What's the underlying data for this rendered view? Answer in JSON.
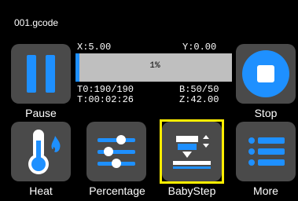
{
  "file_name": "001.gcode",
  "status": {
    "x": "X:5.00",
    "y": "Y:0.00",
    "progress_label": "1%",
    "progress_fraction": 0.01,
    "t0": "T0:190/190",
    "bed": "B:50/50",
    "time": "T:00:02:26",
    "z": "Z:42.00"
  },
  "buttons": {
    "pause": "Pause",
    "stop": "Stop",
    "heat": "Heat",
    "percentage": "Percentage",
    "babystep": "BabyStep",
    "more": "More"
  },
  "colors": {
    "accent": "#1e90ff",
    "tile": "#4a4a4a",
    "selection": "#ffee00",
    "flame": "#1e90ff"
  },
  "icons": {
    "pause": "pause-icon",
    "stop": "stop-icon",
    "heat": "thermometer-flame-icon",
    "percentage": "sliders-icon",
    "babystep": "nozzle-z-adjust-icon",
    "more": "menu-list-icon"
  }
}
